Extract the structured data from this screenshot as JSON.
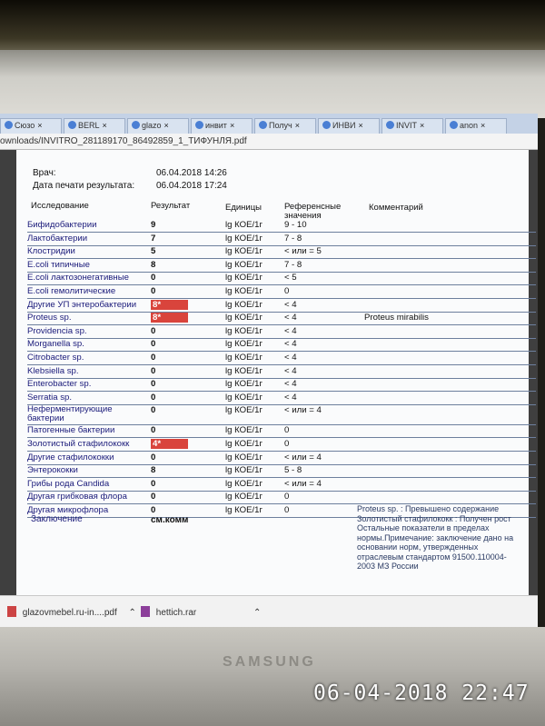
{
  "browser": {
    "tabs": [
      {
        "label": "Сюзо",
        "icon": "doc-icon"
      },
      {
        "label": "BERL",
        "icon": "page-icon"
      },
      {
        "label": "glazo",
        "icon": "doc-icon"
      },
      {
        "label": "инвит",
        "icon": "google-icon"
      },
      {
        "label": "Получ",
        "icon": "drop-icon"
      },
      {
        "label": "ИНВИ",
        "icon": "drop-icon"
      },
      {
        "label": "INVIT",
        "icon": "doc-icon"
      },
      {
        "label": "anon",
        "icon": "google-icon"
      }
    ],
    "url": "ownloads/INVITRO_281189170_86492859_1_ТИФУНЛЯ.pdf"
  },
  "report": {
    "doctor_label": "Врач:",
    "doctor_value": "06.04.2018 14:26",
    "print_date_label": "Дата печати результата:",
    "print_date_value": "06.04.2018 17:24",
    "headers": {
      "test": "Исследование",
      "result": "Результат",
      "units": "Единицы",
      "reference": "Референсные значения",
      "comment": "Комментарий"
    },
    "rows": [
      {
        "name": "Бифидобактерии",
        "result": "9",
        "unit": "lg КОЕ/1г",
        "ref": "9 - 10",
        "comment": "",
        "flag": false
      },
      {
        "name": "Лактобактерии",
        "result": "7",
        "unit": "lg КОЕ/1г",
        "ref": "7 - 8",
        "comment": "",
        "flag": false
      },
      {
        "name": "Клостридии",
        "result": "5",
        "unit": "lg КОЕ/1г",
        "ref": "< или = 5",
        "comment": "",
        "flag": false
      },
      {
        "name": "E.coli типичные",
        "result": "8",
        "unit": "lg КОЕ/1г",
        "ref": "7 - 8",
        "comment": "",
        "flag": false
      },
      {
        "name": "E.coli лактозонегативные",
        "result": "0",
        "unit": "lg КОЕ/1г",
        "ref": "< 5",
        "comment": "",
        "flag": false
      },
      {
        "name": "E.coli гемолитические",
        "result": "0",
        "unit": "lg КОЕ/1г",
        "ref": "0",
        "comment": "",
        "flag": false
      },
      {
        "name": "Другие УП энтеробактерии",
        "result": "8*",
        "unit": "lg КОЕ/1г",
        "ref": "< 4",
        "comment": "",
        "flag": true
      },
      {
        "name": "Proteus sp.",
        "result": "8*",
        "unit": "lg КОЕ/1г",
        "ref": "< 4",
        "comment": "Proteus mirabilis",
        "flag": true
      },
      {
        "name": "Providencia sp.",
        "result": "0",
        "unit": "lg КОЕ/1г",
        "ref": "< 4",
        "comment": "",
        "flag": false
      },
      {
        "name": "Morganella sp.",
        "result": "0",
        "unit": "lg КОЕ/1г",
        "ref": "< 4",
        "comment": "",
        "flag": false
      },
      {
        "name": "Citrobacter sp.",
        "result": "0",
        "unit": "lg КОЕ/1г",
        "ref": "< 4",
        "comment": "",
        "flag": false
      },
      {
        "name": "Klebsiella sp.",
        "result": "0",
        "unit": "lg КОЕ/1г",
        "ref": "< 4",
        "comment": "",
        "flag": false
      },
      {
        "name": "Enterobacter sp.",
        "result": "0",
        "unit": "lg КОЕ/1г",
        "ref": "< 4",
        "comment": "",
        "flag": false
      },
      {
        "name": "Serratia sp.",
        "result": "0",
        "unit": "lg КОЕ/1г",
        "ref": "< 4",
        "comment": "",
        "flag": false
      },
      {
        "name": "Неферментирующие бактерии",
        "result": "0",
        "unit": "lg КОЕ/1г",
        "ref": "< или = 4",
        "comment": "",
        "flag": false
      },
      {
        "name": "Патогенные бактерии",
        "result": "0",
        "unit": "lg КОЕ/1г",
        "ref": "0",
        "comment": "",
        "flag": false
      },
      {
        "name": "Золотистый стафилококк",
        "result": "4*",
        "unit": "lg КОЕ/1г",
        "ref": "0",
        "comment": "",
        "flag": true
      },
      {
        "name": "Другие стафилококки",
        "result": "0",
        "unit": "lg КОЕ/1г",
        "ref": "< или = 4",
        "comment": "",
        "flag": false
      },
      {
        "name": "Энтерококки",
        "result": "8",
        "unit": "lg КОЕ/1г",
        "ref": "5 - 8",
        "comment": "",
        "flag": false
      },
      {
        "name": "Грибы рода Candida",
        "result": "0",
        "unit": "lg КОЕ/1г",
        "ref": "< или = 4",
        "comment": "",
        "flag": false
      },
      {
        "name": "Другая грибковая флора",
        "result": "0",
        "unit": "lg КОЕ/1г",
        "ref": "0",
        "comment": "",
        "flag": false
      },
      {
        "name": "Другая микрофлора",
        "result": "0",
        "unit": "lg КОЕ/1г",
        "ref": "0",
        "comment": "",
        "flag": false
      }
    ],
    "conclusion_label": "Заключение",
    "conclusion_result": "см.комм",
    "conclusion_text": "Proteus sp. : Превышено содержание Золотистый стафилококк : Получен рост Остальные показатели в пределах нормы.Примечание: заключение дано на основании норм, утвержденных отраслевым стандартом 91500.110004-2003 МЗ России"
  },
  "downloads": [
    {
      "name": "glazovmebel.ru-in....pdf",
      "icon": "pdf-icon"
    },
    {
      "name": "hettich.rar",
      "icon": "rar-icon"
    }
  ],
  "photo": {
    "brand": "SAMSUNG",
    "timestamp": "06-04-2018 22:47"
  }
}
